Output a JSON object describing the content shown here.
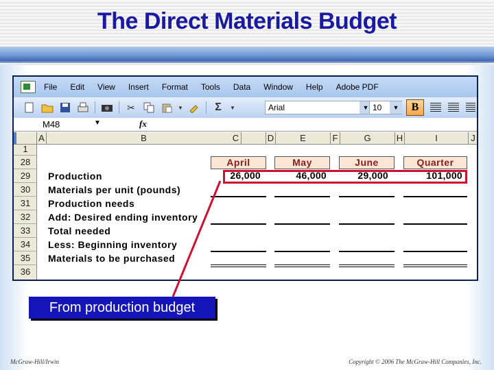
{
  "slide": {
    "title": "The Direct Materials Budget",
    "callout": "From production budget",
    "footer_left": "McGraw-Hill/Irwin",
    "footer_right": "Copyright © 2006 The McGraw-Hill Companies, Inc."
  },
  "excel": {
    "menu": [
      "File",
      "Edit",
      "View",
      "Insert",
      "Format",
      "Tools",
      "Data",
      "Window",
      "Help",
      "Adobe PDF"
    ],
    "toolbar": {
      "font": "Arial",
      "font_size": "10",
      "bold_label": "B",
      "sum_label": "Σ"
    },
    "name_box": "M48",
    "fx_label": "fx",
    "columns": [
      "A",
      "B",
      "C",
      "D",
      "E",
      "F",
      "G",
      "H",
      "I",
      "J"
    ],
    "rows": [
      "1",
      "28",
      "29",
      "30",
      "31",
      "32",
      "33",
      "34",
      "35",
      "36"
    ],
    "labels": [
      "Production",
      "Materials per unit (pounds)",
      "Production needs",
      "Add: Desired ending inventory",
      "Total needed",
      "Less: Beginning inventory",
      "Materials to be purchased"
    ],
    "period_headers": [
      "April",
      "May",
      "June",
      "Quarter"
    ],
    "production_values": [
      "26,000",
      "46,000",
      "29,000",
      "101,000"
    ]
  },
  "colors": {
    "title": "#1a1aa0",
    "header_text": "#8b1a1a",
    "header_fill": "#fbe6d6",
    "highlight": "#d01030",
    "callout_bg": "#1414b8"
  }
}
